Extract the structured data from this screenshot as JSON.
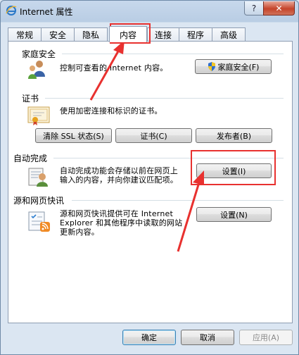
{
  "window": {
    "title": "Internet 属性",
    "help_label": "?",
    "close_label": "✕"
  },
  "tabs": [
    {
      "label": "常规"
    },
    {
      "label": "安全"
    },
    {
      "label": "隐私"
    },
    {
      "label": "内容"
    },
    {
      "label": "连接"
    },
    {
      "label": "程序"
    },
    {
      "label": "高级"
    }
  ],
  "active_tab": "内容",
  "sections": {
    "family": {
      "title": "家庭安全",
      "desc": "控制可查看的 Internet 内容。",
      "button": "家庭安全(F)"
    },
    "cert": {
      "title": "证书",
      "desc": "使用加密连接和标识的证书。",
      "buttons": [
        "清除 SSL 状态(S)",
        "证书(C)",
        "发布者(B)"
      ]
    },
    "autocomplete": {
      "title": "自动完成",
      "desc_line1": "自动完成功能会存储以前在网页上",
      "desc_line2": "输入的内容，并向你建议匹配项。",
      "button": "设置(I)"
    },
    "feeds": {
      "title": "源和网页快讯",
      "desc_line1": "源和网页快讯提供可在 Internet",
      "desc_line2": "Explorer 和其他程序中读取的网站",
      "desc_line3": "更新内容。",
      "button": "设置(N)"
    }
  },
  "footer": {
    "ok": "确定",
    "cancel": "取消",
    "apply": "应用(A)"
  },
  "colors": {
    "highlight": "#e8312f",
    "panel_bg": "#ffffff",
    "frame_bg": "#dbe6f2"
  }
}
